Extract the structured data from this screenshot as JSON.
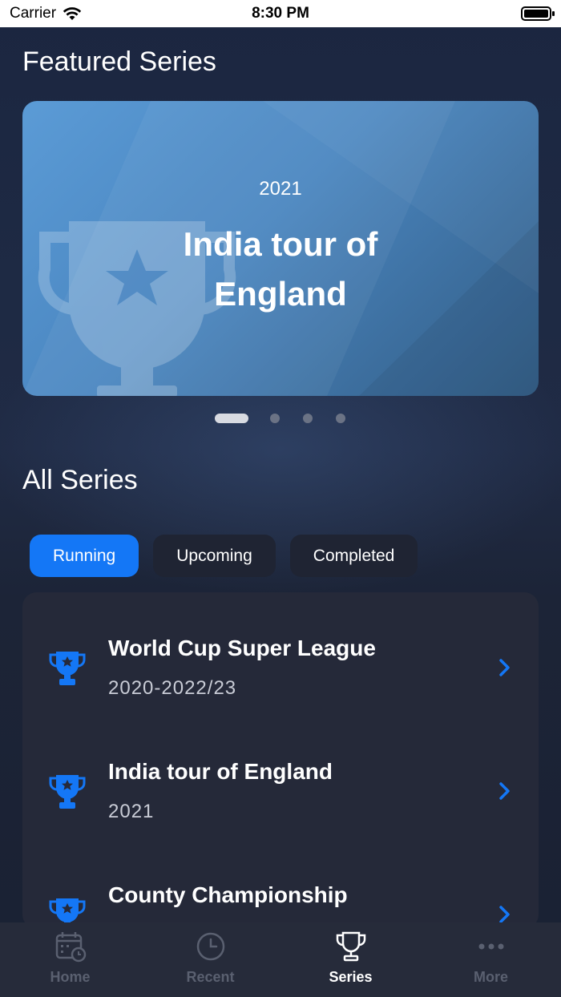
{
  "status_bar": {
    "carrier": "Carrier",
    "time": "8:30 PM"
  },
  "featured": {
    "section_title": "Featured Series",
    "card": {
      "year": "2021",
      "title": "India tour of England"
    },
    "pager": {
      "count": 4,
      "active_index": 0
    }
  },
  "all_series": {
    "section_title": "All Series",
    "filters": [
      {
        "label": "Running",
        "selected": true
      },
      {
        "label": "Upcoming",
        "selected": false
      },
      {
        "label": "Completed",
        "selected": false
      }
    ],
    "items": [
      {
        "name": "World Cup Super League",
        "years": "2020-2022/23"
      },
      {
        "name": "India tour of England",
        "years": "2021"
      },
      {
        "name": "County Championship",
        "years": ""
      }
    ]
  },
  "tab_bar": {
    "tabs": [
      {
        "label": "Home",
        "icon": "calendar-icon",
        "active": false
      },
      {
        "label": "Recent",
        "icon": "clock-icon",
        "active": false
      },
      {
        "label": "Series",
        "icon": "trophy-icon",
        "active": true
      },
      {
        "label": "More",
        "icon": "more-dots-icon",
        "active": false
      }
    ]
  },
  "colors": {
    "accent": "#1477f6",
    "background": "#1a2236",
    "card": "#4a86c0",
    "tab_inactive": "#5a6070"
  }
}
